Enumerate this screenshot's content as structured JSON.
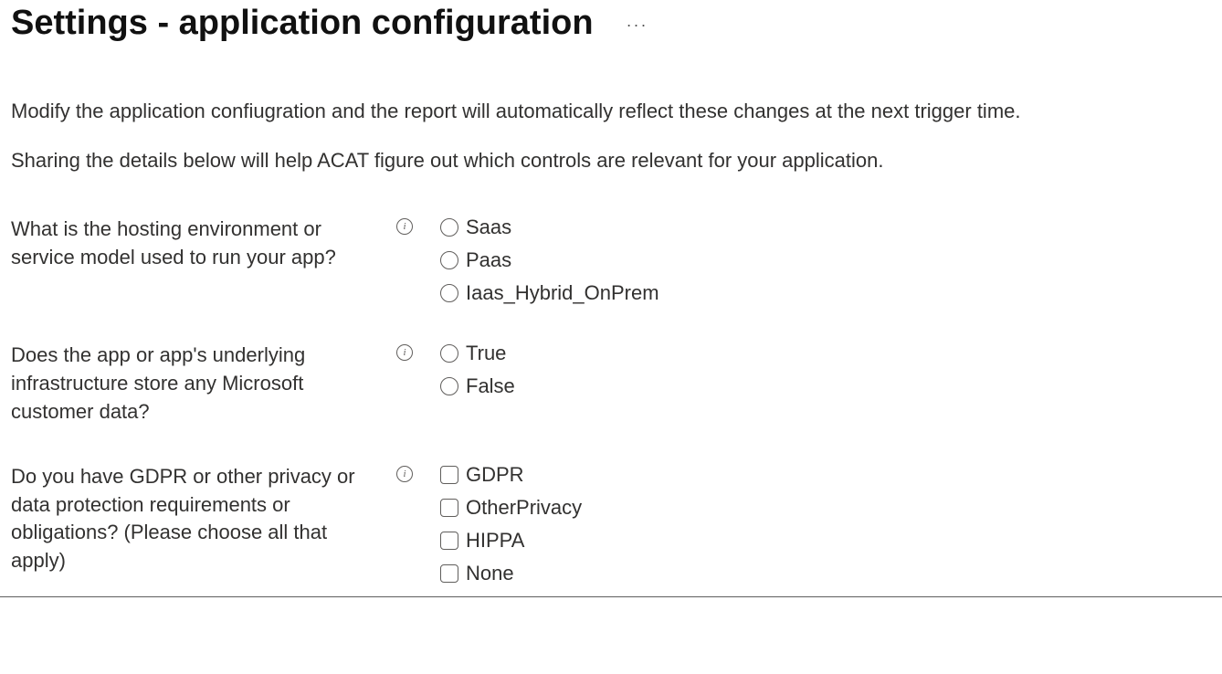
{
  "header": {
    "title": "Settings - application configuration",
    "more_label": "···"
  },
  "intro": {
    "line1": "Modify the application confiugration and the report will automatically reflect these changes at the next trigger time.",
    "line2": "Sharing the details below will help ACAT figure out which controls are relevant for your application."
  },
  "questions": [
    {
      "label": "What is the hosting environment or service model used to run your app?",
      "type": "radio",
      "options": [
        "Saas",
        "Paas",
        "Iaas_Hybrid_OnPrem"
      ]
    },
    {
      "label": "Does the app or app's underlying infrastructure store any Microsoft customer data?",
      "type": "radio",
      "options": [
        "True",
        "False"
      ]
    },
    {
      "label": "Do you have GDPR or other privacy or data protection requirements or obligations? (Please choose all that apply)",
      "type": "checkbox",
      "options": [
        "GDPR",
        "OtherPrivacy",
        "HIPPA",
        "None"
      ]
    }
  ]
}
